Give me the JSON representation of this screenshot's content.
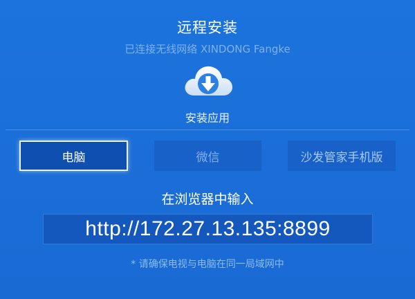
{
  "header": {
    "title": "远程安装",
    "connection_status": "已连接无线网络 XINDONG Fangke"
  },
  "install": {
    "icon": "cloud-download-icon",
    "label": "安装应用"
  },
  "tabs": [
    {
      "label": "电脑",
      "selected": true
    },
    {
      "label": "微信",
      "selected": false
    },
    {
      "label": "沙发管家手机版",
      "selected": false
    }
  ],
  "instructions": {
    "prompt": "在浏览器中输入",
    "url": "http://172.27.13.135:8899",
    "note": "* 请确保电视与电脑在同一局域网中"
  },
  "colors": {
    "background": "#1c73dc",
    "selected_tab_bg": "#0e4fb0",
    "inactive_tab_bg": "#1861c9",
    "muted_text": "#7fb1ee"
  }
}
